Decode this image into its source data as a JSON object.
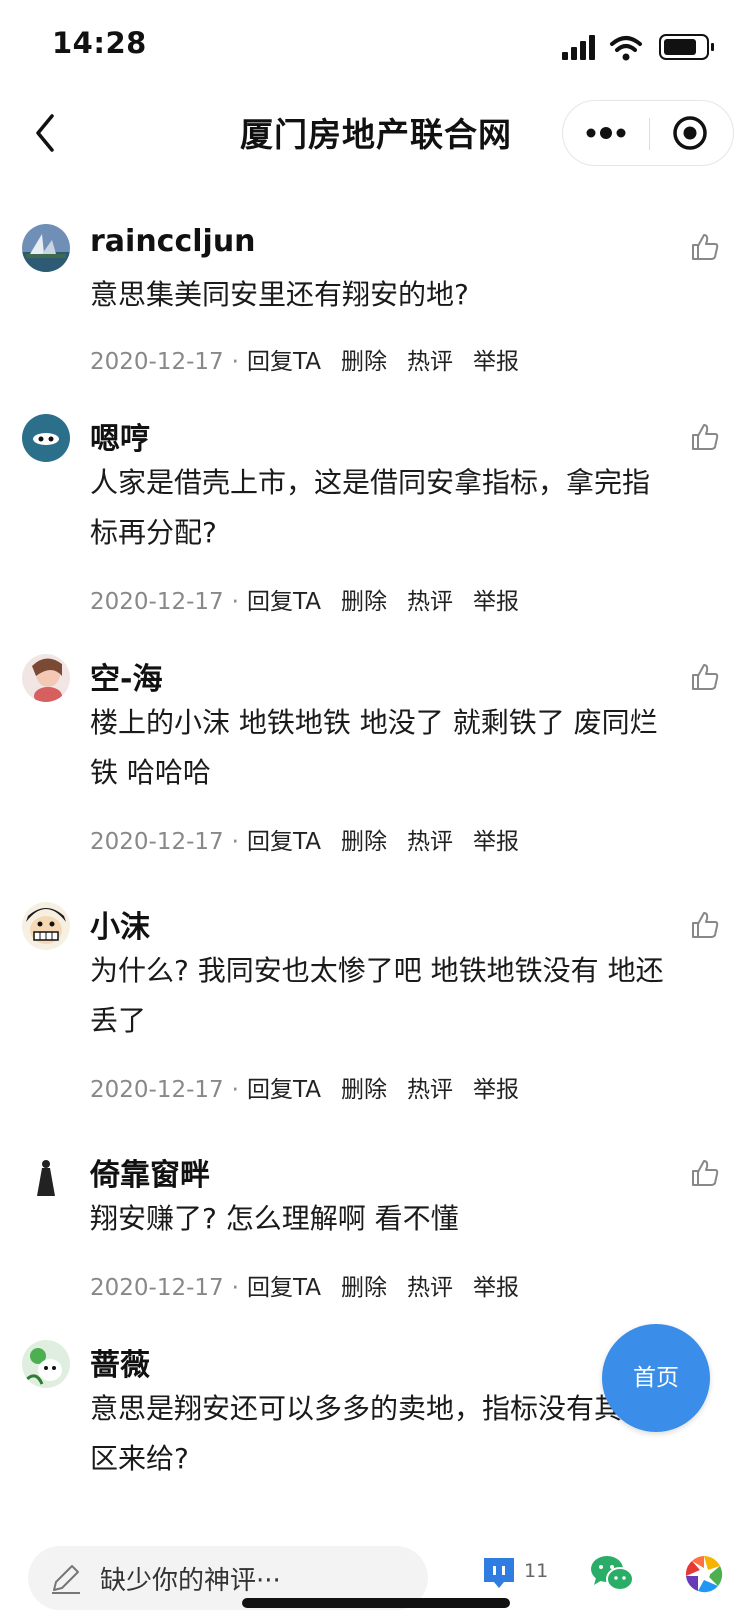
{
  "status": {
    "time": "14:28"
  },
  "nav": {
    "title": "厦门房地产联合网",
    "back_icon": "chevron-left-icon",
    "more_icon": "more-dots-icon",
    "close_icon": "target-icon"
  },
  "comments": [
    {
      "username": "rainccljun",
      "content_lines": [
        "意思集美同安里还有翔安的地?"
      ],
      "date": "2020-12-17",
      "actions": [
        "回复TA",
        "删除",
        "热评",
        "举报"
      ]
    },
    {
      "username": "嗯哼",
      "content_lines": [
        "人家是借壳上市，这是借同安拿指标，拿完指",
        "标再分配?"
      ],
      "date": "2020-12-17",
      "actions": [
        "回复TA",
        "删除",
        "热评",
        "举报"
      ]
    },
    {
      "username": "空-海",
      "content_lines": [
        "楼上的小沫 地铁地铁 地没了 就剩铁了 废同烂",
        "铁 哈哈哈"
      ],
      "date": "2020-12-17",
      "actions": [
        "回复TA",
        "删除",
        "热评",
        "举报"
      ]
    },
    {
      "username": "小沫",
      "content_lines": [
        "为什么? 我同安也太惨了吧 地铁地铁没有 地还",
        "丢了"
      ],
      "date": "2020-12-17",
      "actions": [
        "回复TA",
        "删除",
        "热评",
        "举报"
      ]
    },
    {
      "username": "倚靠窗畔",
      "content_lines": [
        "翔安赚了? 怎么理解啊 看不懂"
      ],
      "date": "2020-12-17",
      "actions": [
        "回复TA",
        "删除",
        "热评",
        "举报"
      ]
    },
    {
      "username": "蔷薇",
      "content_lines": [
        "意思是翔安还可以多多的卖地，指标没有其他",
        "区来给?"
      ],
      "date": "",
      "actions": []
    }
  ],
  "fab": {
    "label": "首页"
  },
  "bottom": {
    "placeholder": "缺少你的神评···",
    "comment_count": "11"
  },
  "colors": {
    "accent": "#3a8de8",
    "wechat": "#2aae67",
    "comment_icon": "#2f7de1"
  }
}
